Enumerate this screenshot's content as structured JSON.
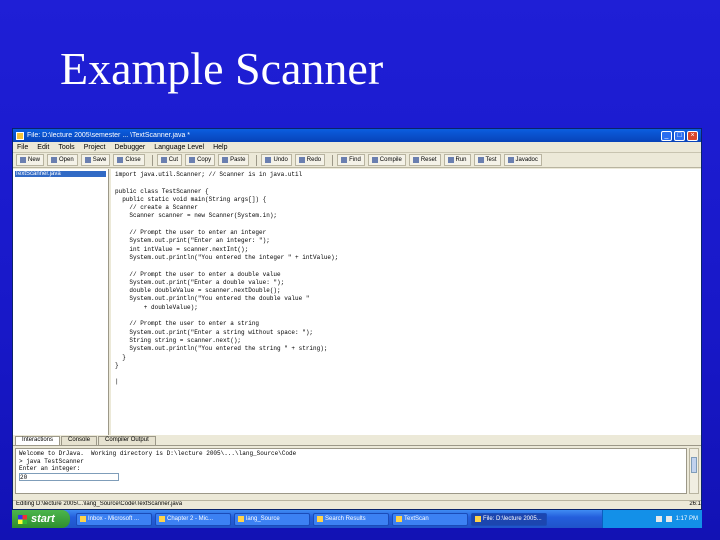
{
  "slide": {
    "title": "Example Scanner"
  },
  "window": {
    "title": "File: D:\\lecture 2005\\semester ... \\TextScanner.java *",
    "buttons": {
      "minimize": "_",
      "maximize": "□",
      "close": "×"
    }
  },
  "menu": [
    "File",
    "Edit",
    "Tools",
    "Project",
    "Debugger",
    "Language Level",
    "Help"
  ],
  "toolbar": {
    "new": "New",
    "open": "Open",
    "save": "Save",
    "close": "Close",
    "cut": "Cut",
    "copy": "Copy",
    "paste": "Paste",
    "undo": "Undo",
    "redo": "Redo",
    "find": "Find",
    "compile": "Compile",
    "reset": "Reset",
    "run": "Run",
    "test": "Test",
    "javadoc": "Javadoc"
  },
  "files": [
    "TextScanner.java"
  ],
  "editor": {
    "code": "import java.util.Scanner; // Scanner is in java.util\n\npublic class TestScanner {\n  public static void main(String args[]) {\n    // create a Scanner\n    Scanner scanner = new Scanner(System.in);\n\n    // Prompt the user to enter an integer\n    System.out.print(\"Enter an integer: \");\n    int intValue = scanner.nextInt();\n    System.out.println(\"You entered the integer \" + intValue);\n\n    // Prompt the user to enter a double value\n    System.out.print(\"Enter a double value: \");\n    double doubleValue = scanner.nextDouble();\n    System.out.println(\"You entered the double value \"\n        + doubleValue);\n\n    // Prompt the user to enter a string\n    System.out.print(\"Enter a string without space: \");\n    String string = scanner.next();\n    System.out.println(\"You entered the string \" + string);\n  }\n}\n\n|"
  },
  "bottom": {
    "tabs": [
      "Interactions",
      "Console",
      "Compiler Output"
    ],
    "interactions_text": "Welcome to DrJava.  Working directory is D:\\lecture 2005\\...\\lang_Source\\Code\n> java TestScanner\nEnter an integer:",
    "answer_value": "20"
  },
  "status": {
    "left": "Editing D:\\lecture 2005\\...\\lang_Source\\Code\\TextScanner.java",
    "right": "26:1"
  },
  "taskbar": {
    "start_label": "start",
    "tasks": [
      "Inbox - Microsoft ...",
      "Chapter 2 - Mic...",
      "lang_Source",
      "Search Results",
      "TextScan",
      "File: D:\\lecture 2005..."
    ],
    "clock": "1:17 PM"
  }
}
